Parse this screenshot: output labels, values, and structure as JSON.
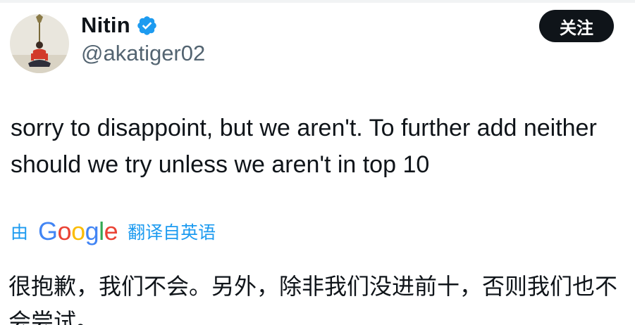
{
  "tweet": {
    "author": {
      "display_name": "Nitin",
      "handle": "@akatiger02",
      "verified": true,
      "verified_icon": "verified-badge-icon"
    },
    "follow_label": "关注",
    "text": "sorry to disappoint, but we aren't. To further add neither should we try unless we aren't in top 10",
    "translation": {
      "by_label": "由",
      "provider_letters": [
        "G",
        "o",
        "o",
        "g",
        "l",
        "e"
      ],
      "from_label": "翻译自英语",
      "text": "很抱歉，我们不会。另外，除非我们没进前十，否则我们也不会尝试。"
    }
  },
  "colors": {
    "accent": "#1d9bf0",
    "text_primary": "#0f1419",
    "text_secondary": "#536471",
    "button_bg": "#0f1419",
    "google_blue": "#4285f4",
    "google_red": "#ea4335",
    "google_yellow": "#fbbc05",
    "google_green": "#34a853"
  }
}
